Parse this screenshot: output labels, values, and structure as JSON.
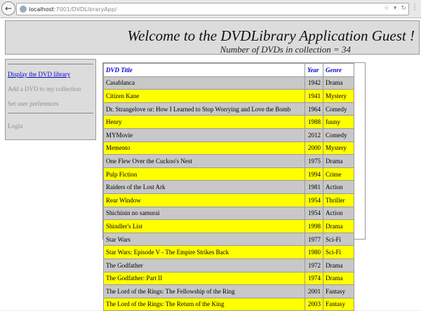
{
  "browser": {
    "url_host": "localhost",
    "url_path": ":7001/DVDLibraryApp/"
  },
  "header": {
    "title": "Welcome to the DVDLibrary Application Guest !",
    "subtitle": "Number of DVDs in collection = 34"
  },
  "sidebar": {
    "items": [
      {
        "label": "Display the DVD library",
        "enabled": true
      },
      {
        "label": "Add a DVD to my collection",
        "enabled": false
      },
      {
        "label": "Set user preferences",
        "enabled": false
      },
      {
        "label": "Login",
        "enabled": false
      }
    ]
  },
  "table": {
    "headers": [
      "DVD Title",
      "Year",
      "Genre"
    ],
    "rows": [
      [
        "Casablanca",
        "1942",
        "Drama"
      ],
      [
        "Citizen Kane",
        "1941",
        "Mystery"
      ],
      [
        "Dr. Strangelove or: How I Learned to Stop Worrying and Love the Bomb",
        "1964",
        "Comedy"
      ],
      [
        "Henry",
        "1988",
        "fuuny"
      ],
      [
        "MYMovie",
        "2012",
        "Comedy"
      ],
      [
        "Memento",
        "2000",
        "Mystery"
      ],
      [
        "One Flew Over the Cuckoo's Nest",
        "1975",
        "Drama"
      ],
      [
        "Pulp Fiction",
        "1994",
        "Crime"
      ],
      [
        "Raiders of the Lost Ark",
        "1981",
        "Action"
      ],
      [
        "Rear Window",
        "1954",
        "Thriller"
      ],
      [
        "Shichinin no samurai",
        "1954",
        "Action"
      ],
      [
        "Shindler's List",
        "1998",
        "Drama"
      ],
      [
        "Star Wars",
        "1977",
        "Sci-Fi"
      ],
      [
        "Star Wars: Episode V - The Empire Strikes Back",
        "1980",
        "Sci-Fi"
      ],
      [
        "The Godfather",
        "1972",
        "Drama"
      ],
      [
        "The Godfather: Part II",
        "1974",
        "Drama"
      ],
      [
        "The Lord of the Rings: The Fellowship of the Ring",
        "2001",
        "Fantasy"
      ],
      [
        "The Lord of the Rings: The Return of the King",
        "2003",
        "Fantasy"
      ]
    ]
  },
  "colors": {
    "row_odd": "#c8c8c8",
    "row_even": "#ffff00",
    "link": "#0000cc",
    "panel": "#dcdcdc"
  }
}
